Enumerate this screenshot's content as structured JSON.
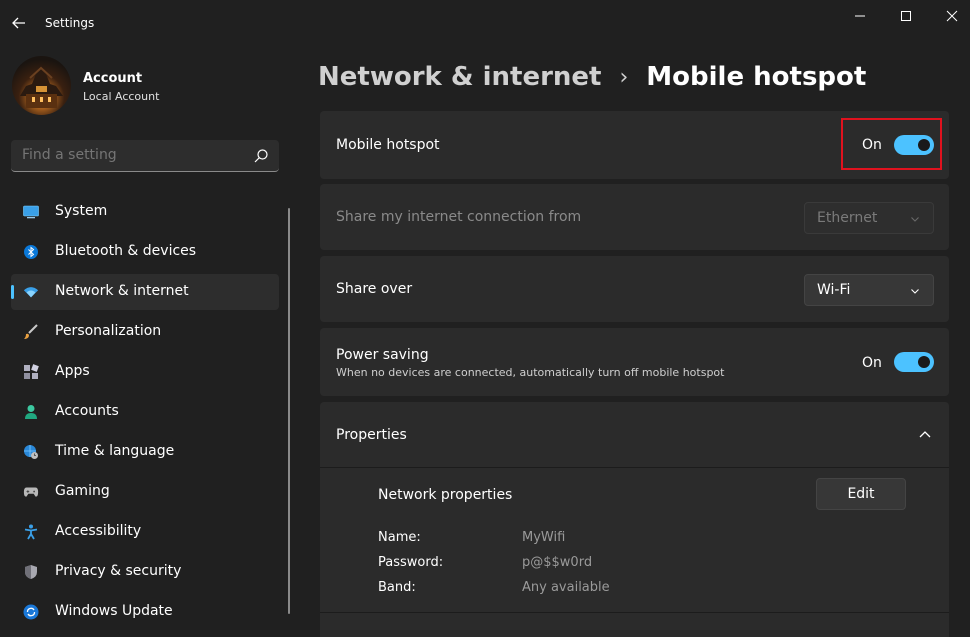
{
  "window": {
    "title": "Settings",
    "controls": [
      "minimize-icon",
      "maximize-icon",
      "close-icon"
    ]
  },
  "account": {
    "name": "Account",
    "type": "Local Account"
  },
  "search": {
    "placeholder": "Find a setting"
  },
  "sidebar": {
    "items": [
      {
        "label": "System",
        "icon": "monitor-icon",
        "active": false
      },
      {
        "label": "Bluetooth & devices",
        "icon": "bluetooth-icon",
        "active": false
      },
      {
        "label": "Network & internet",
        "icon": "wifi-icon",
        "active": true
      },
      {
        "label": "Personalization",
        "icon": "brush-icon",
        "active": false
      },
      {
        "label": "Apps",
        "icon": "apps-icon",
        "active": false
      },
      {
        "label": "Accounts",
        "icon": "person-icon",
        "active": false
      },
      {
        "label": "Time & language",
        "icon": "globe-clock-icon",
        "active": false
      },
      {
        "label": "Gaming",
        "icon": "gamepad-icon",
        "active": false
      },
      {
        "label": "Accessibility",
        "icon": "accessibility-icon",
        "active": false
      },
      {
        "label": "Privacy & security",
        "icon": "shield-icon",
        "active": false
      },
      {
        "label": "Windows Update",
        "icon": "update-icon",
        "active": false
      }
    ]
  },
  "breadcrumb": {
    "parent": "Network & internet",
    "separator": "›",
    "current": "Mobile hotspot"
  },
  "hotspot": {
    "label": "Mobile hotspot",
    "state": "On"
  },
  "share_from": {
    "label": "Share my internet connection from",
    "value": "Ethernet"
  },
  "share_over": {
    "label": "Share over",
    "value": "Wi-Fi"
  },
  "power_saving": {
    "label": "Power saving",
    "description": "When no devices are connected, automatically turn off mobile hotspot",
    "state": "On"
  },
  "properties": {
    "label": "Properties",
    "section_title": "Network properties",
    "edit_label": "Edit",
    "fields": [
      {
        "key": "Name:",
        "value": "MyWifi"
      },
      {
        "key": "Password:",
        "value": "p@$$w0rd"
      },
      {
        "key": "Band:",
        "value": "Any available"
      }
    ]
  },
  "colors": {
    "accent": "#4cc2ff",
    "highlight": "#e0121e",
    "background": "#202020",
    "card": "#2b2b2b"
  }
}
